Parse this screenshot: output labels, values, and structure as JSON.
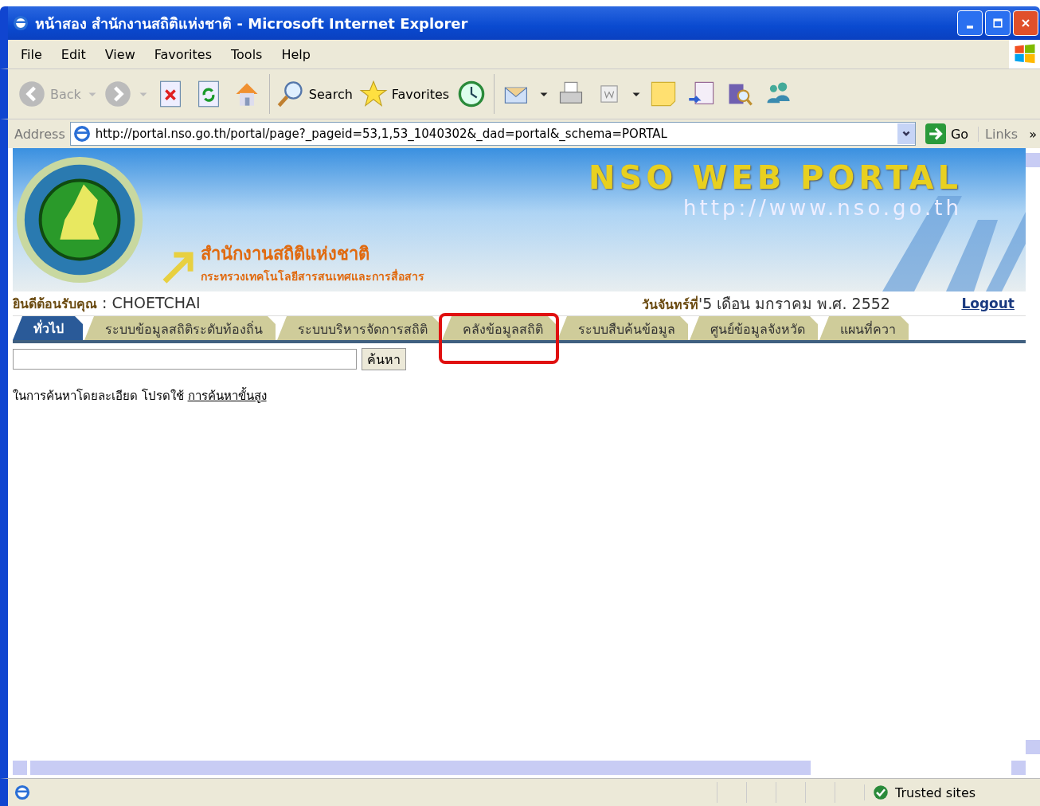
{
  "window": {
    "title": "หน้าสอง สำนักงานสถิติแห่งชาติ - Microsoft Internet Explorer"
  },
  "menu": [
    "File",
    "Edit",
    "View",
    "Favorites",
    "Tools",
    "Help"
  ],
  "toolbar": {
    "back": "Back",
    "search": "Search",
    "favorites": "Favorites"
  },
  "address_bar": {
    "label": "Address",
    "value": "http://portal.nso.go.th/portal/page?_pageid=53,1,53_1040302&_dad=portal&_schema=PORTAL",
    "go": "Go",
    "links": "Links",
    "more": "»"
  },
  "banner": {
    "org_name": "สำนักงานสถิติแห่งชาติ",
    "ministry": "กระทรวงเทคโนโลยีสารสนเทศและการสื่อสาร",
    "portal_title": "NSO WEB PORTAL",
    "portal_url": "http://www.nso.go.th"
  },
  "welcome": {
    "label": "ยินดีต้อนรับคุณ",
    "separator": ":",
    "user": "CHOETCHAI"
  },
  "date": {
    "prefix": "วันจันทร์ที่",
    "value": "'5 เดือน มกราคม พ.ศ. 2552"
  },
  "logout": "Logout",
  "tabs": [
    {
      "label": "ทั่วไป",
      "selected": true,
      "highlighted": false
    },
    {
      "label": "ระบบข้อมูลสถิติระดับท้องถิ่น",
      "selected": false,
      "highlighted": false
    },
    {
      "label": "ระบบบริหารจัดการสถิติ",
      "selected": false,
      "highlighted": false
    },
    {
      "label": "คลังข้อมูลสถิติ",
      "selected": false,
      "highlighted": true
    },
    {
      "label": "ระบบสืบค้นข้อมูล",
      "selected": false,
      "highlighted": false
    },
    {
      "label": "ศูนย์ข้อมูลจังหวัด",
      "selected": false,
      "highlighted": false
    },
    {
      "label": "แผนที่ควา",
      "selected": false,
      "highlighted": false
    }
  ],
  "search": {
    "button": "ค้นหา"
  },
  "advanced_hint": {
    "text": "ในการค้นหาโดยละเอียด โปรดใช้",
    "link": "การค้นหาขั้นสูง"
  },
  "status_bar": {
    "zone": "Trusted sites"
  }
}
